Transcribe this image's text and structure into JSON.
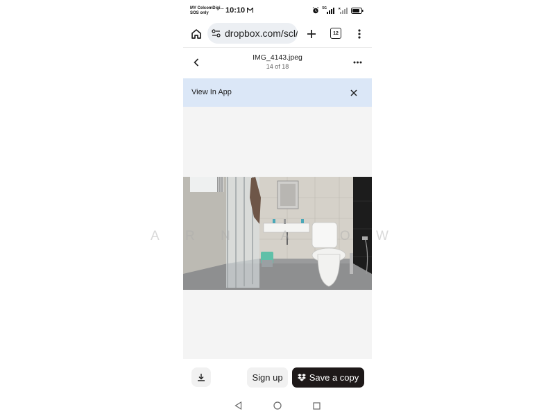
{
  "status_bar": {
    "carrier_line1": "MY CelcomDigi...",
    "carrier_line2": "SOS only",
    "time": "10:10",
    "network": "5G"
  },
  "browser": {
    "url": "dropbox.com/scl/",
    "tab_count": "12"
  },
  "file_header": {
    "file_name": "IMG_4143.jpeg",
    "position": "14 of 18"
  },
  "banner": {
    "text": "View In App"
  },
  "watermark": {
    "letters": [
      "A",
      "R",
      "N",
      "",
      "A",
      "",
      "O",
      "W"
    ]
  },
  "actions": {
    "signup_label": "Sign up",
    "save_label": "Save a copy"
  },
  "colors": {
    "banner_bg": "#dbe7f7",
    "save_button_bg": "#1e1919",
    "viewer_bg": "#f4f4f4"
  },
  "icons": [
    "home-icon",
    "site-settings-icon",
    "plus-icon",
    "tabs-icon",
    "more-vert-icon",
    "chevron-left-icon",
    "more-horiz-icon",
    "close-icon",
    "download-icon",
    "dropbox-icon",
    "nav-back-icon",
    "nav-home-icon",
    "nav-recents-icon"
  ]
}
